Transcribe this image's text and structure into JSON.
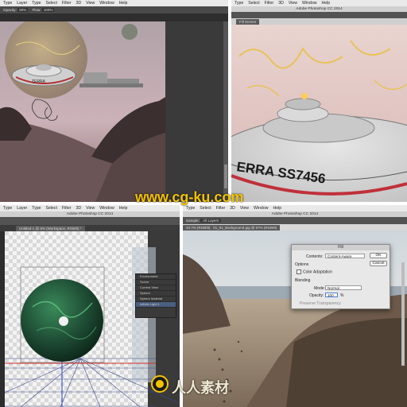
{
  "top_left": {
    "menu": [
      "Type",
      "Layer",
      "Type",
      "Select",
      "Filter",
      "3D",
      "View",
      "Window",
      "Help"
    ],
    "options": {
      "opacity_label": "Opacity:",
      "opacity_value": "80%",
      "flow_label": "Flow:",
      "flow_value": "100%"
    },
    "ufo_text": "TERRA"
  },
  "top_right": {
    "menu": [
      "Type",
      "Select",
      "Filter",
      "3D",
      "View",
      "Window",
      "Help"
    ],
    "title": "Adobe Photoshop CC 2014",
    "doc_tab": "Fill Screen",
    "hull_text": "ERRA SS7456"
  },
  "bottom_left": {
    "menu": [
      "Type",
      "Layer",
      "Type",
      "Select",
      "Filter",
      "3D",
      "View",
      "Window",
      "Help"
    ],
    "title": "Adobe Photoshop CC 2014",
    "doc_tab": "Untitled-1 @ 8% (Workspace, RGB/8) *",
    "layers": [
      "Environment",
      "Scene",
      "Current View",
      "Sphere",
      "Sphere Material",
      "Infinite Light 1"
    ]
  },
  "bottom_right": {
    "menu": [
      "Type",
      "Select",
      "Filter",
      "3D",
      "View",
      "Window",
      "Help"
    ],
    "title": "Adobe Photoshop CC 2014",
    "doc_tab": "01_01_Background.jpg @ 67% (RGB/8)",
    "zoom": "33.7% (RGB/8)",
    "sample_label": "Sample:",
    "sample_value": "All Layers"
  },
  "fill_dialog": {
    "title": "Fill",
    "contents_label": "Contents:",
    "contents_value": "Content-Aware",
    "options_label": "Options",
    "color_adaptation": "Color Adaptation",
    "blending_label": "Blending",
    "mode_label": "Mode:",
    "mode_value": "Normal",
    "opacity_label": "Opacity:",
    "opacity_value": "100",
    "opacity_unit": "%",
    "preserve_transparency": "Preserve Transparency",
    "ok": "OK",
    "cancel": "Cancel"
  },
  "watermarks": {
    "site": "www.cg-ku.com",
    "cn": "人人素材"
  },
  "colors": {
    "watermark": "#f5c400",
    "menubar": "#e9e9e9",
    "ps_dark": "#2b2b2b"
  }
}
